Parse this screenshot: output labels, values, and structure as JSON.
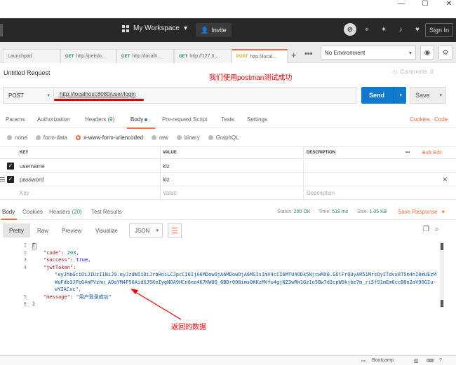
{
  "window": {
    "minimize": "—",
    "maximize": "☐",
    "close": "✕"
  },
  "topbar": {
    "workspace": "My Workspace",
    "invite": "Invite",
    "signin": "Sign In"
  },
  "tabs": [
    {
      "method": "",
      "label": "Launchpad"
    },
    {
      "method": "GET",
      "label": "http://petsto..."
    },
    {
      "method": "GET",
      "label": "http://localh..."
    },
    {
      "method": "GET",
      "label": "http://127.0...."
    },
    {
      "method": "POST",
      "label": "http://local..."
    }
  ],
  "environment": {
    "selected": "No Environment"
  },
  "request": {
    "name": "Untitled Request",
    "comments_label": "Comments",
    "comments_count": "0",
    "annotation": "我们使用postman测试成功",
    "method": "POST",
    "url": "http://localhost:8080/user/login",
    "send": "Send",
    "save": "Save"
  },
  "request_tabs": {
    "params": "Params",
    "authorization": "Authorization",
    "headers": "Headers",
    "headers_count": "(9)",
    "body": "Body",
    "pre_request": "Pre-request Script",
    "tests": "Tests",
    "settings": "Settings",
    "cookies": "Cookies",
    "code": "Code"
  },
  "body_options": {
    "none": "none",
    "form_data": "form-data",
    "urlencoded": "x-www-form-urlencoded",
    "raw": "raw",
    "binary": "binary",
    "graphql": "GraphQL"
  },
  "kv_table": {
    "col_key": "KEY",
    "col_value": "VALUE",
    "col_desc": "DESCRIPTION",
    "more": "•••",
    "bulk_edit": "Bulk Edit",
    "rows": [
      {
        "key": "username",
        "value": "klz"
      },
      {
        "key": "password",
        "value": "klz"
      }
    ],
    "placeholder_key": "Key",
    "placeholder_value": "Value",
    "placeholder_desc": "Description"
  },
  "response_tabs": {
    "body": "Body",
    "cookies": "Cookies",
    "headers": "Headers",
    "headers_count": "(20)",
    "test_results": "Test Results",
    "status_label": "Status:",
    "status_value": "200 OK",
    "time_label": "Time:",
    "time_value": "518 ms",
    "size_label": "Size:",
    "size_value": "1.05 KB",
    "save_response": "Save Response"
  },
  "view_bar": {
    "pretty": "Pretty",
    "raw": "Raw",
    "preview": "Preview",
    "visualize": "Visualize",
    "format": "JSON"
  },
  "code": {
    "line_numbers": [
      "1",
      "2",
      "3",
      "4",
      "",
      "",
      "",
      "5",
      "6"
    ],
    "open_brace": "{",
    "close_brace": "}",
    "code_key": "\"code\"",
    "code_val": "203",
    "success_key": "\"success\"",
    "success_val": "true",
    "jwt_key": "\"jwtToken\"",
    "jwt_line1": "\"eyJhbGciOiJIUzI1NiJ9.eyJzdWIiOiJrbHoiLCJpcCI6IjA6MDowOjA6MDowOjA6MSIsImV4cCI6MTU4ODk5NjcwMX0.GOlFrQUyAR51MrsQyITdvx8T5m4nI0mUEzM",
    "jwt_line2": "WuFdb3JFbG4nPVzhu_AOaYM4F56AidXJ5KeIygNOA9HCn8ee4K7KWUQ_6BDr0O8ims0KKzMVfu4gjNZ3wRk1Gz1o5Bw7d3cpW9kjbe7m_ri5f91mEm6ccB8n2aV9OGIu-",
    "jwt_line3": "wYIACxc\",",
    "message_key": "\"message\"",
    "message_val": "\"用户登录成功\""
  },
  "annotation_bottom": "返回的数据",
  "status_bar": {
    "bootcamp": "Bootcamp"
  }
}
